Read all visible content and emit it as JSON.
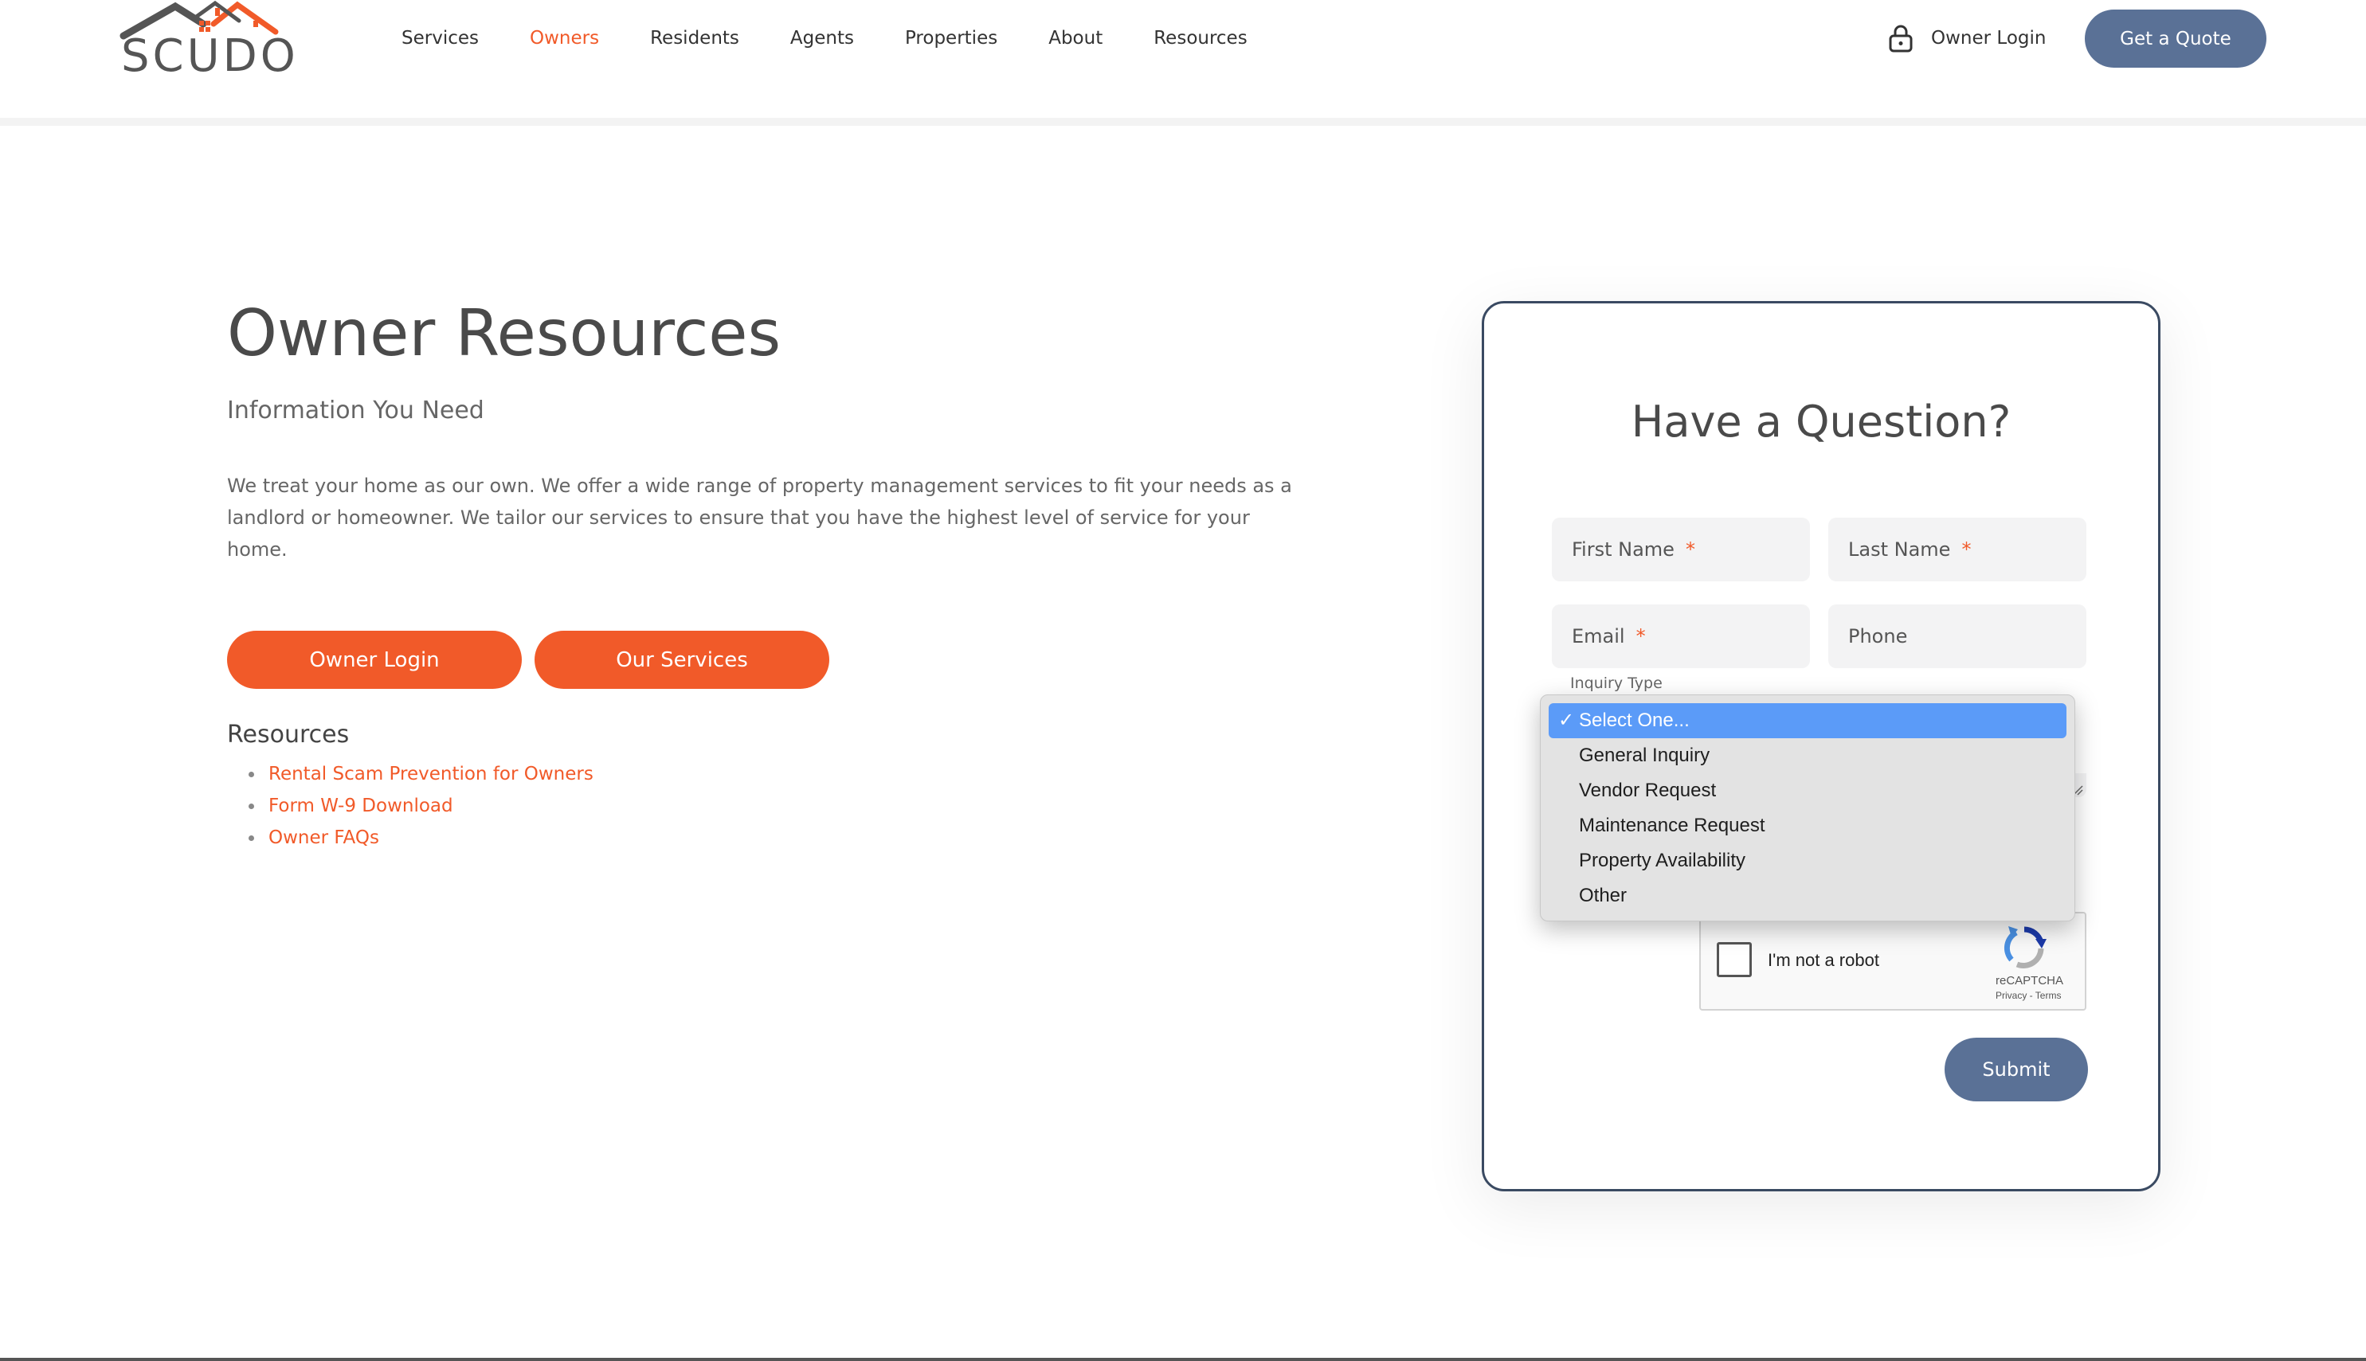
{
  "brand": {
    "name": "SCUDO"
  },
  "nav": [
    {
      "label": "Services",
      "active": false
    },
    {
      "label": "Owners",
      "active": true
    },
    {
      "label": "Residents",
      "active": false
    },
    {
      "label": "Agents",
      "active": false
    },
    {
      "label": "Properties",
      "active": false
    },
    {
      "label": "About",
      "active": false
    },
    {
      "label": "Resources",
      "active": false
    }
  ],
  "header": {
    "owner_login": "Owner Login",
    "quote_button": "Get a Quote"
  },
  "hero": {
    "title": "Owner Resources",
    "subtitle": "Information You Need",
    "description": "We treat your home as our own. We offer a wide range of property management services to fit your needs as a landlord or homeowner. We tailor our services to ensure that you have the highest level of service for your home.",
    "owner_login_button": "Owner Login",
    "services_button": "Our Services"
  },
  "resources": {
    "heading": "Resources",
    "links": [
      "Rental Scam Prevention for Owners",
      "Form W-9 Download",
      "Owner FAQs"
    ]
  },
  "form": {
    "title": "Have a Question?",
    "first_name": "First Name",
    "last_name": "Last Name",
    "email": "Email",
    "phone": "Phone",
    "required_mark": "*",
    "inquiry_label": "Inquiry Type",
    "submit": "Submit"
  },
  "dropdown": {
    "options": [
      "Select One...",
      "General Inquiry",
      "Vendor Request",
      "Maintenance Request",
      "Property Availability",
      "Other"
    ],
    "selected_index": 0,
    "check": "✓"
  },
  "recaptcha": {
    "label": "I'm not a robot",
    "brand": "reCAPTCHA",
    "links": "Privacy - Terms"
  },
  "colors": {
    "accent": "#f15a29",
    "primary": "#5a7196",
    "select_highlight": "#5b9bf8"
  }
}
